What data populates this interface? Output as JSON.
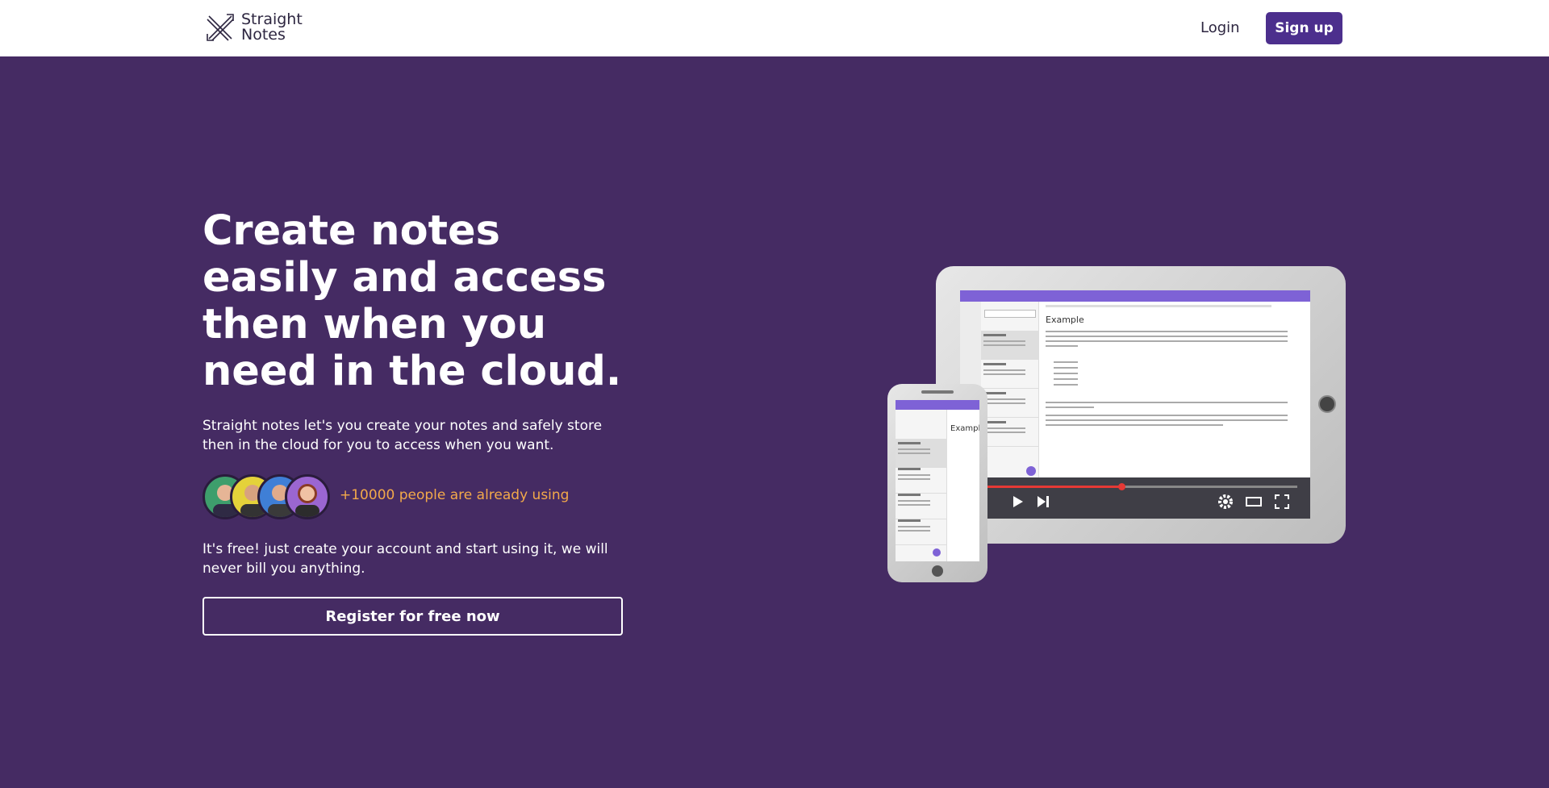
{
  "header": {
    "logo_line1": "Straight",
    "logo_line2": "Notes",
    "login_label": "Login",
    "signup_label": "Sign up"
  },
  "hero": {
    "title": "Create notes easily and access then when you need in the cloud.",
    "description": "Straight notes let's you create your notes and safely store then in the cloud for you to access when you want.",
    "users_count": "+10000 people are already using",
    "free_text": "It's free! just create your account and start using it, we will never bill you anything.",
    "register_label": "Register for free now"
  },
  "mockup": {
    "doc_title": "Example"
  },
  "colors": {
    "background": "#452b63",
    "primary_button": "#4c2f8d",
    "accent_text": "#f3a94a",
    "app_bar": "#7e62d6"
  },
  "icons": [
    "straight-notes-logo-icon",
    "play-icon",
    "skip-next-icon",
    "settings-icon",
    "theater-mode-icon",
    "fullscreen-icon",
    "add-note-icon",
    "search-icon"
  ]
}
